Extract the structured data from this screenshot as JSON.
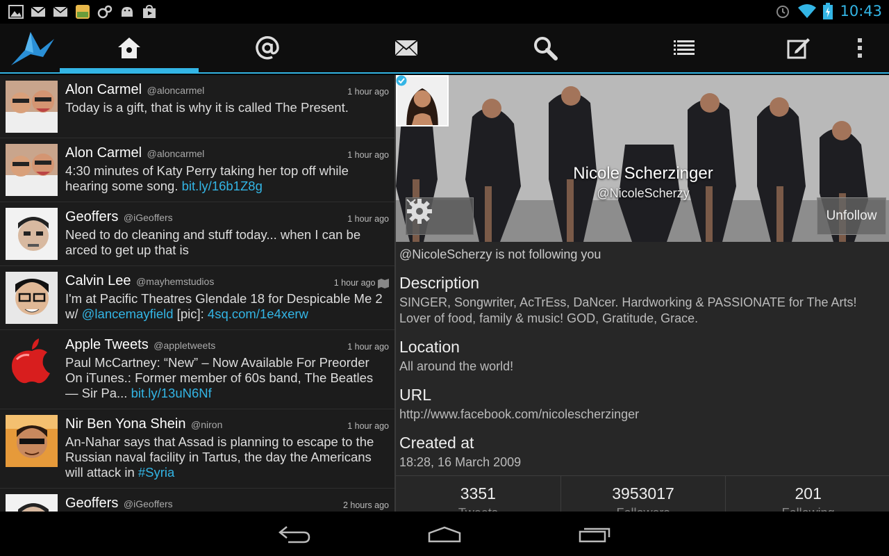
{
  "status_bar": {
    "time": "10:43",
    "left_icons": [
      "gallery-icon",
      "gmail-icon",
      "email-icon",
      "app-icon",
      "sync-icon",
      "android-icon",
      "play-store-icon"
    ],
    "right_icons": [
      "alarm-icon",
      "wifi-icon",
      "battery-icon"
    ]
  },
  "colors": {
    "accent": "#33b5e5",
    "background": "#1b1b1b"
  },
  "action_bar": {
    "tabs": [
      "home-icon",
      "mentions-icon",
      "messages-icon",
      "search-icon",
      "lists-icon",
      "compose-icon",
      "overflow-icon"
    ]
  },
  "timeline": [
    {
      "name": "Alon Carmel",
      "handle": "@aloncarmel",
      "time": "1 hour ago",
      "text": "Today is a gift, that is why it is called The Present.",
      "link": ""
    },
    {
      "name": "Alon Carmel",
      "handle": "@aloncarmel",
      "time": "1 hour ago",
      "text": "4:30 minutes of Katy Perry taking her top off while hearing some song. ",
      "link": "bit.ly/16b1Z8g"
    },
    {
      "name": "Geoffers",
      "handle": "@iGeoffers",
      "time": "1 hour ago",
      "text": "Need to do cleaning and stuff today... when I can be arced to get up that is",
      "link": ""
    },
    {
      "name": "Calvin Lee",
      "handle": "@mayhemstudios",
      "time": "1 hour ago",
      "text_a": "I'm at Pacific Theatres Glendale 18 for Despicable Me 2 w/ ",
      "mention": "@lancemayfield",
      "text_b": " [pic]: ",
      "link": "4sq.com/1e4xerw"
    },
    {
      "name": "Apple Tweets",
      "handle": "@appletweets",
      "time": "1 hour ago",
      "text": "Paul McCartney: “New” – Now Available For Preorder On iTunes.: Former member of 60s band, The Beatles — Sir Pa... ",
      "link": "bit.ly/13uN6Nf"
    },
    {
      "name": "Nir Ben Yona Shein",
      "handle": "@niron",
      "time": "1 hour ago",
      "text": "An-Nahar says that Assad is planning to escape to the Russian naval facility in Tartus, the day the Americans will attack in ",
      "link": "#Syria"
    },
    {
      "name": "Geoffers",
      "handle": "@iGeoffers",
      "time": "2 hours ago",
      "text": "",
      "link": ""
    }
  ],
  "profile": {
    "name": "Nicole Scherzinger",
    "handle": "@NicoleScherzy",
    "unfollow_label": "Unfollow",
    "follow_status": "@NicoleScherzy is not following you",
    "description_label": "Description",
    "description": "SINGER, Songwriter, AcTrEss, DaNcer. Hardworking & PASSIONATE for The Arts! Lover of food, family & music! GOD, Gratitude, Grace.",
    "location_label": "Location",
    "location": "All around the world!",
    "url_label": "URL",
    "url": "http://www.facebook.com/nicolescherzinger",
    "created_label": "Created at",
    "created": "18:28, 16 March 2009",
    "stats": [
      {
        "value": "3351",
        "label": "Tweets"
      },
      {
        "value": "3953017",
        "label": "Followers"
      },
      {
        "value": "201",
        "label": "Following"
      }
    ]
  },
  "nav_bar": [
    "back-icon",
    "home-icon",
    "recent-apps-icon"
  ]
}
